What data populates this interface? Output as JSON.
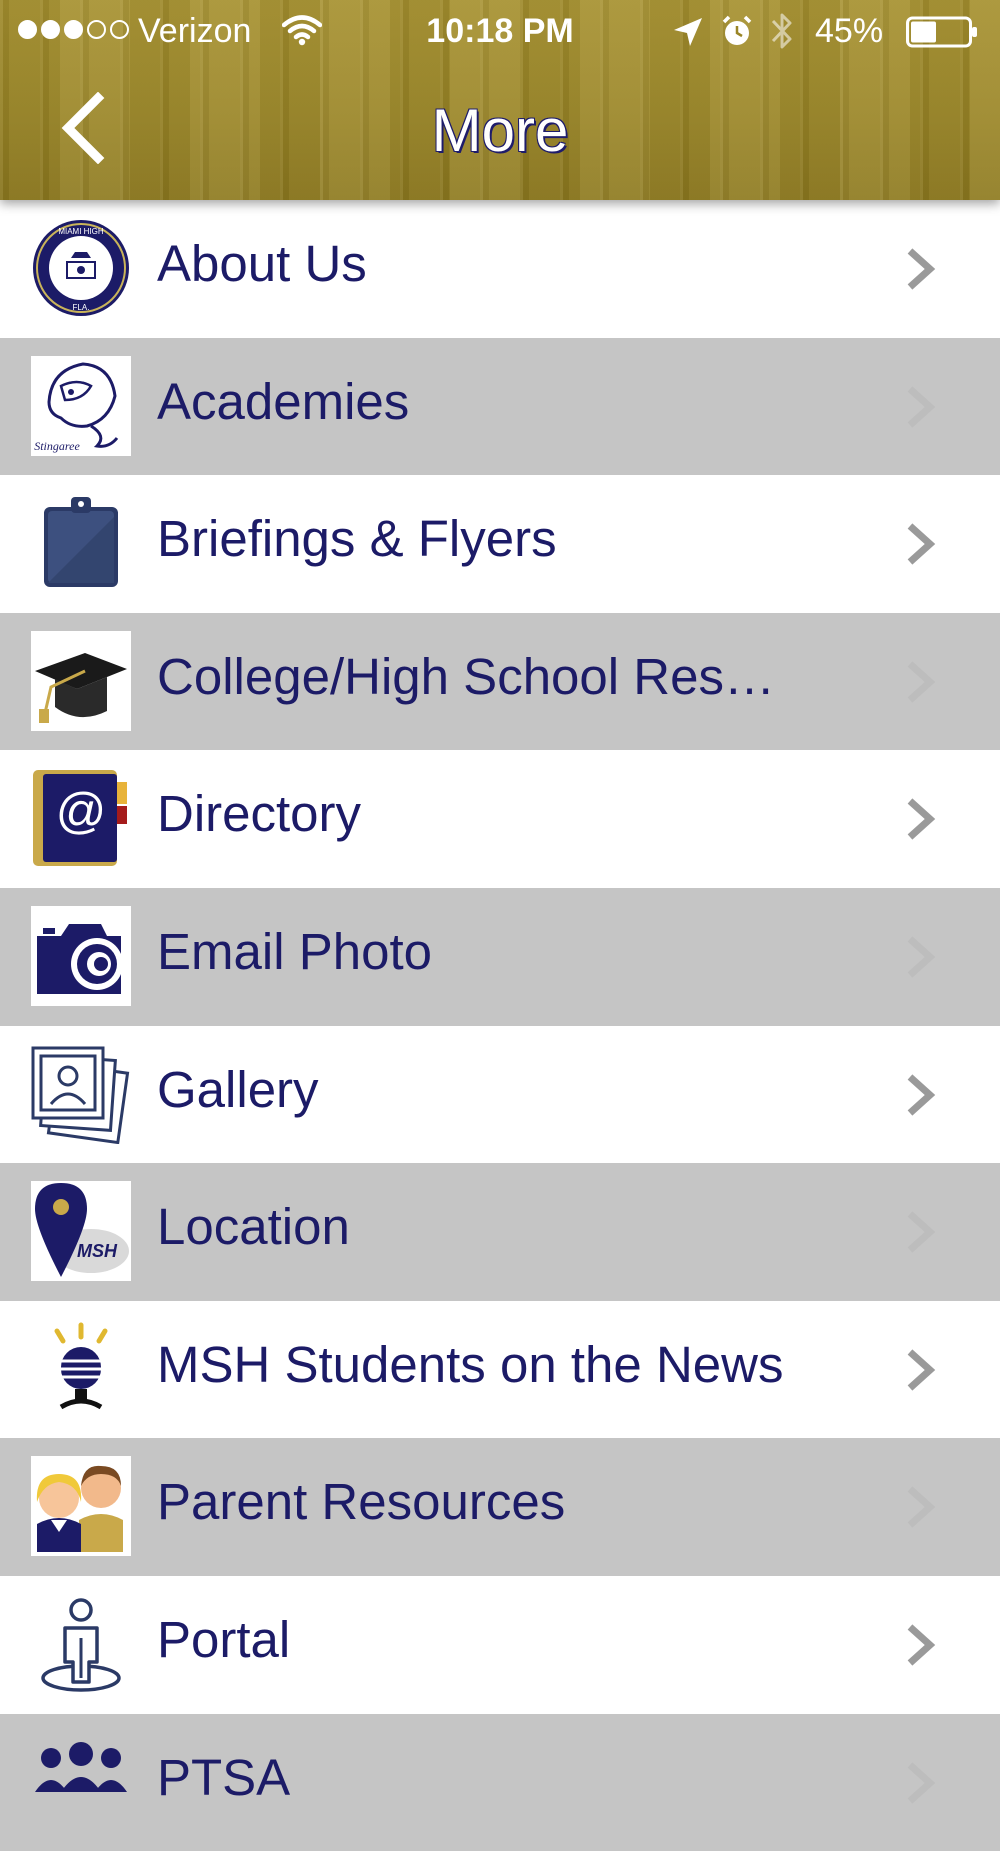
{
  "status_bar": {
    "carrier": "Verizon",
    "time": "10:18 PM",
    "battery_percent": "45%",
    "battery_level": 0.45,
    "signal_bars_filled": 3,
    "signal_bars_total": 5
  },
  "nav": {
    "title": "More",
    "back_icon": "chevron-left-icon"
  },
  "colors": {
    "header": "#9a8526",
    "label_text": "#1c1b67",
    "row_alt": "#c5c5c5"
  },
  "menu": {
    "items": [
      {
        "label": "About Us",
        "icon": "school-seal-icon"
      },
      {
        "label": "Academies",
        "icon": "stingaree-icon"
      },
      {
        "label": "Briefings & Flyers",
        "icon": "clipboard-icon"
      },
      {
        "label": "College/High School Res…",
        "icon": "graduation-cap-icon"
      },
      {
        "label": "Directory",
        "icon": "address-book-icon"
      },
      {
        "label": "Email Photo",
        "icon": "camera-icon"
      },
      {
        "label": "Gallery",
        "icon": "photo-stack-icon"
      },
      {
        "label": "Location",
        "icon": "map-pin-icon"
      },
      {
        "label": "MSH Students on the News",
        "icon": "microphone-icon"
      },
      {
        "label": "Parent Resources",
        "icon": "parents-icon"
      },
      {
        "label": "Portal",
        "icon": "person-portal-icon"
      },
      {
        "label": "PTSA",
        "icon": "group-icon"
      }
    ]
  }
}
